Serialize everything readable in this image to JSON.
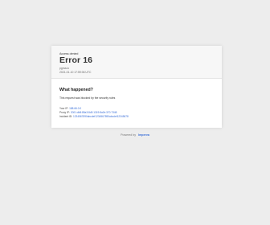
{
  "header": {
    "eyebrow": "Access denied",
    "title": "Error 16",
    "host": "pgma.io",
    "timestamp": "2021-01-10 17:59:06 UTC"
  },
  "body": {
    "section_title": "What happened?",
    "explanation": "This request was blocked by the security rules",
    "details": [
      {
        "label": "Your IP:",
        "value": "188.66.0.0"
      },
      {
        "label": "Proxy IP:",
        "value": "2001:db8:85a3:8d3:1319:8a2e:370:7348"
      },
      {
        "label": "Incident ID:",
        "value": "1234567890abcdef1234567890abcdef12345678"
      }
    ]
  },
  "footer": {
    "prefix": "Powered by",
    "brand": "Imperva"
  },
  "colors": {
    "link": "#3a6fd8",
    "background": "#ededed",
    "card": "#ffffff",
    "card_header": "#f7f7f7"
  }
}
